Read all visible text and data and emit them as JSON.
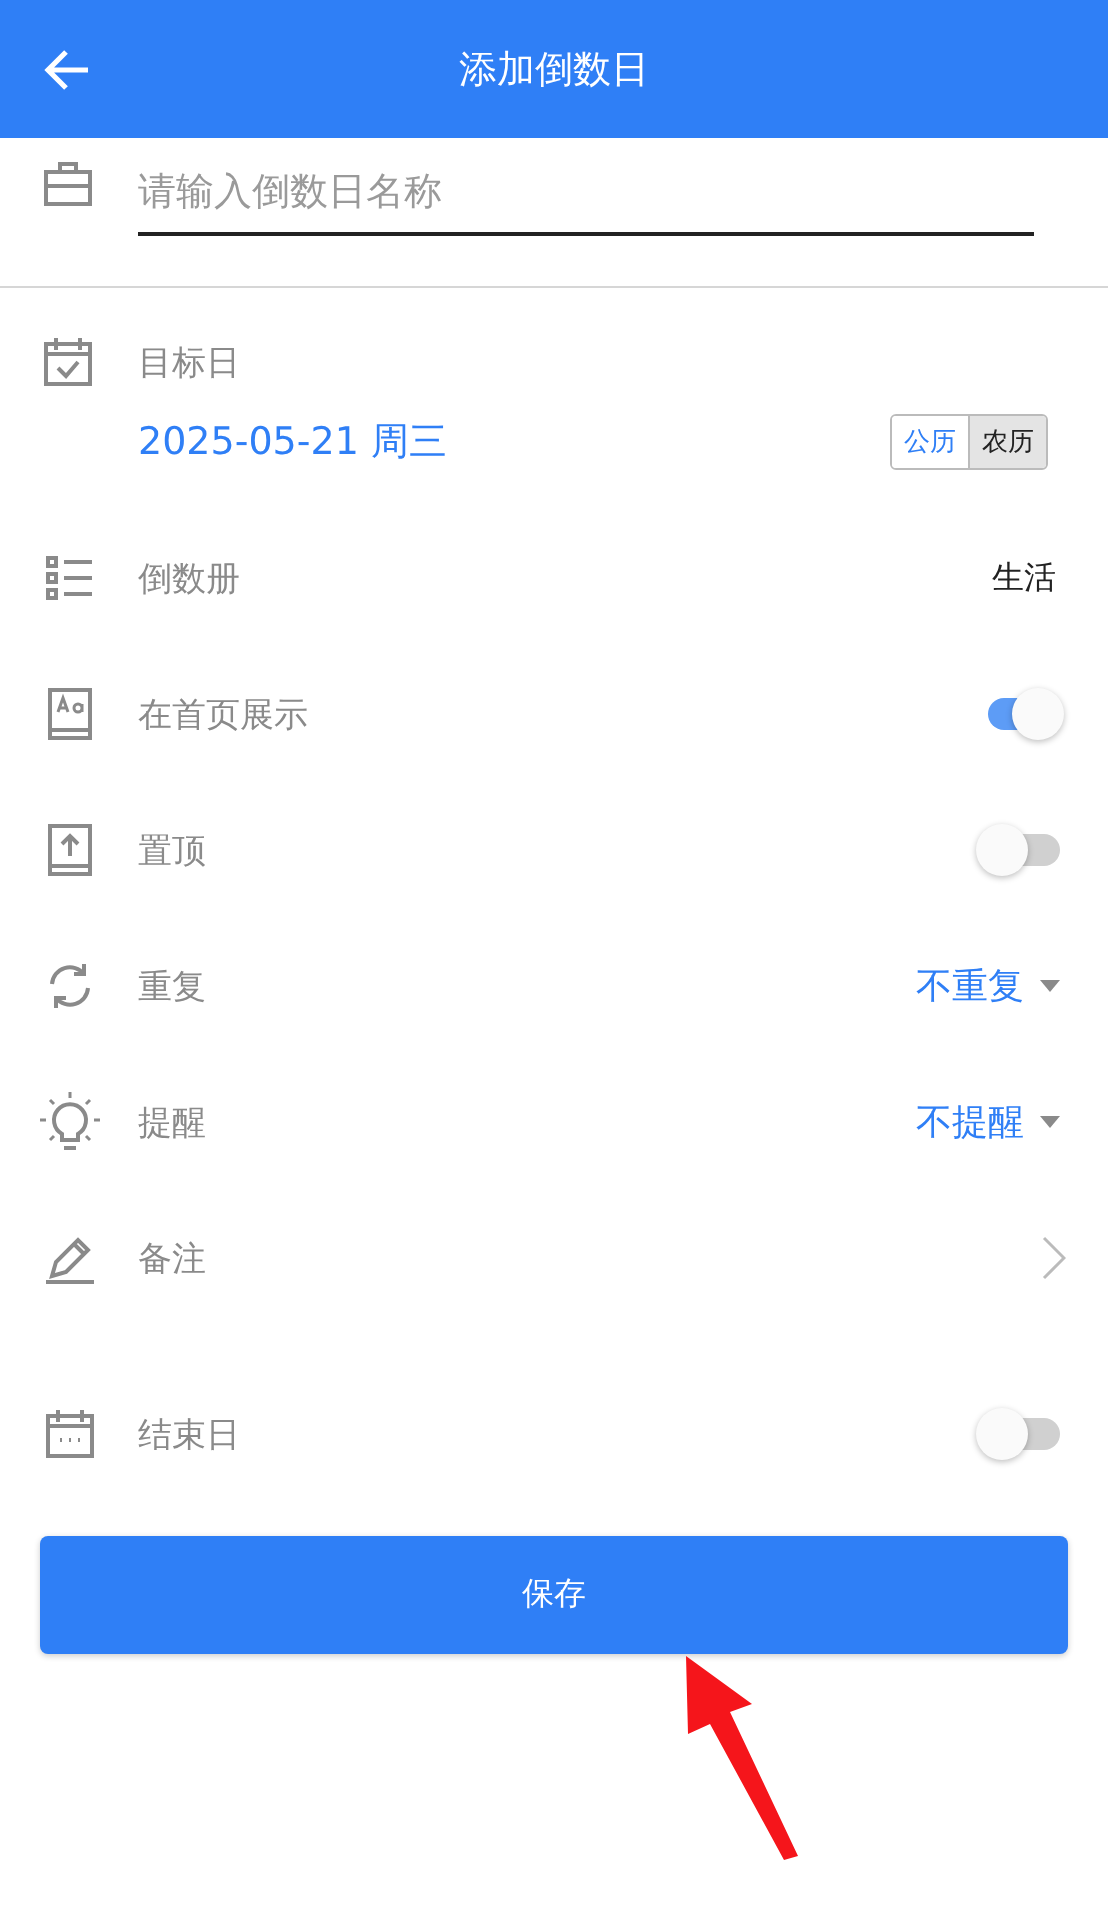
{
  "header": {
    "title": "添加倒数日"
  },
  "name_field": {
    "placeholder": "请输入倒数日名称"
  },
  "target_date": {
    "label": "目标日",
    "value": "2025-05-21 周三",
    "calendar_options": [
      {
        "label": "公历",
        "selected": true
      },
      {
        "label": "农历",
        "selected": false
      }
    ]
  },
  "settings": [
    {
      "kind": "value",
      "label": "倒数册",
      "value": "生活"
    },
    {
      "kind": "switch",
      "label": "在首页展示",
      "on": true
    },
    {
      "kind": "switch",
      "label": "置顶",
      "on": false
    },
    {
      "kind": "dropdown",
      "label": "重复",
      "value": "不重复"
    },
    {
      "kind": "dropdown",
      "label": "提醒",
      "value": "不提醒"
    },
    {
      "kind": "link",
      "label": "备注"
    },
    {
      "kind": "switch",
      "label": "结束日",
      "on": false
    }
  ],
  "save_button": {
    "label": "保存"
  }
}
